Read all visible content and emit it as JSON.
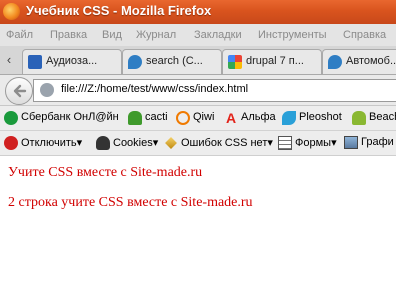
{
  "window": {
    "title": "Учебник CSS - Mozilla Firefox"
  },
  "menu": [
    "Файл",
    "Правка",
    "Вид",
    "Журнал",
    "Закладки",
    "Инструменты",
    "Справка"
  ],
  "tabs": [
    {
      "label": "Аудиоза...",
      "icon": "audio-icon",
      "color": "#2a62b8"
    },
    {
      "label": "search (C...",
      "icon": "drupal-icon",
      "color": "#2f7ec4"
    },
    {
      "label": "drupal 7 п...",
      "icon": "google-icon",
      "color": "#3cba54"
    },
    {
      "label": "Автомоб...",
      "icon": "drupal-icon",
      "color": "#2f7ec4"
    }
  ],
  "address": {
    "url": "file:///Z:/home/test/www/css/index.html"
  },
  "bookmarks": [
    {
      "label": "Сбербанк ОнЛ@йн",
      "icon": "sberbank-icon",
      "color": "#1a9a3c"
    },
    {
      "label": "cacti",
      "icon": "cacti-icon",
      "color": "#3f9a2c"
    },
    {
      "label": "Qiwi",
      "icon": "qiwi-icon",
      "color": "#f07a00"
    },
    {
      "label": "Альфа",
      "icon": "alfa-icon",
      "color": "#e2231a"
    },
    {
      "label": "Pleoshot",
      "icon": "pleoshot-icon",
      "color": "#2aa0d8"
    },
    {
      "label": "Beach",
      "icon": "android-icon",
      "color": "#8ab832"
    }
  ],
  "toolbar2": [
    {
      "label": "Отключить▾",
      "icon": "disable-icon",
      "color": "#d02020"
    },
    {
      "label": "Cookies▾",
      "icon": "cookies-icon",
      "color": "#333333"
    },
    {
      "label": "Ошибок CSS нет▾",
      "icon": "css-wand-icon",
      "color": "#c08a10"
    },
    {
      "label": "Формы▾",
      "icon": "forms-icon",
      "color": "#555555"
    },
    {
      "label": "Графи",
      "icon": "images-icon",
      "color": "#5a7aa0"
    }
  ],
  "content": {
    "line1": "Учите CSS вместе с Site-made.ru",
    "line2": "2 строка учите CSS вместе с Site-made.ru",
    "text_color": "#d10000"
  }
}
